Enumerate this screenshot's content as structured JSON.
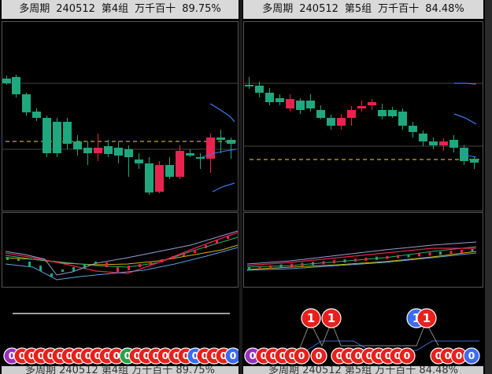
{
  "left_panel": {
    "title": {
      "name": "多周期",
      "code": "240512",
      "group": "第4组",
      "digits": "万千百十",
      "percent": "89.75%"
    },
    "bottom_title": "多周期 240512 第4组 万千百十 89.75%"
  },
  "right_panel": {
    "title": {
      "name": "多周期",
      "code": "240512",
      "group": "第5组",
      "digits": "万千百十",
      "percent": "84.48%"
    },
    "bottom_title": "多周期 240512 第5组 万千百十 84.48%"
  },
  "colors": {
    "up": "#e8234d",
    "down": "#1fa77d",
    "dashed_line": "#c8b000",
    "ball_red": "#e8201c",
    "ball_blue": "#3c6cf0",
    "ball_purple": "#9a2fc0",
    "ball_green": "#27a34a"
  },
  "balls": {
    "zero": "0",
    "one": "1"
  }
}
